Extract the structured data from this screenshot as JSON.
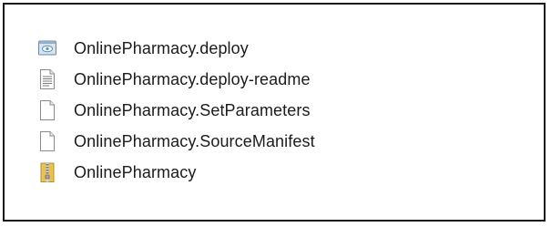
{
  "files": [
    {
      "name": "OnlinePharmacy.deploy",
      "icon": "deploy-script-icon"
    },
    {
      "name": "OnlinePharmacy.deploy-readme",
      "icon": "text-document-icon"
    },
    {
      "name": "OnlinePharmacy.SetParameters",
      "icon": "blank-file-icon"
    },
    {
      "name": "OnlinePharmacy.SourceManifest",
      "icon": "blank-file-icon"
    },
    {
      "name": "OnlinePharmacy",
      "icon": "zip-archive-icon"
    }
  ],
  "colors": {
    "frame_border": "#1a1a1a",
    "text": "#1b1b1b",
    "zip_yellow": "#e8c252",
    "deploy_blue": "#5f8fb6"
  }
}
